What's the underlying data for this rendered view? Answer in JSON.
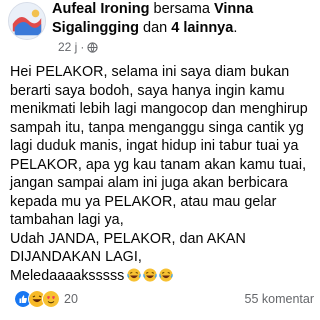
{
  "post": {
    "author": "Aufeal Ironing",
    "connector": " bersama ",
    "tagged_name": "Vinna Sigalingging",
    "connector2": " dan ",
    "others": "4 lainnya",
    "trailing": ".",
    "timestamp": "22 j",
    "separator": "·",
    "body": "Hei PELAKOR, selama ini saya diam bukan berarti saya bodoh, saya hanya ingin kamu menikmati lebih lagi mangocop dan menghirup sampah itu, tanpa menganggu singa cantik yg lagi duduk manis, ingat hidup ini tabur tuai ya PELAKOR, apa yg kau tanam akan kamu tuai, jangan sampai alam ini juga akan berbicara kepada mu ya PELAKOR, atau mau gelar tambahan lagi ya,\nUdah JANDA, PELAKOR, dan AKAN DIJANDAKAN LAGI,\nMeledaaaaksssss",
    "body_emojis": [
      "laughing-emoji",
      "laughing-emoji",
      "laughing-emoji"
    ]
  },
  "footer": {
    "reaction_icons": [
      "like-icon",
      "haha-icon",
      "love-icon"
    ],
    "reaction_count": "20",
    "comment_count": "55 komentar"
  },
  "colors": {
    "like": "#1877f2",
    "haha": "#f7b928",
    "love": "#f33e58",
    "meta": "#65676b"
  }
}
